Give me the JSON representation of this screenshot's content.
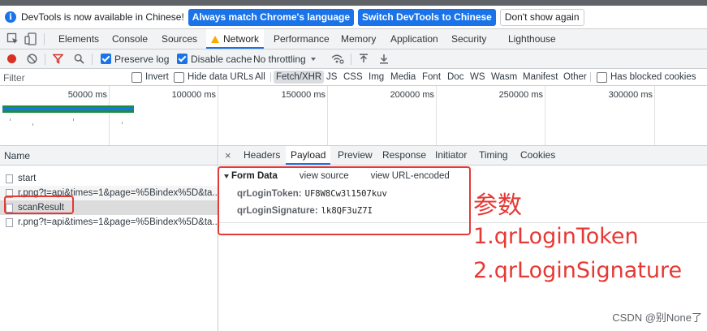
{
  "infobar": {
    "message": "DevTools is now available in Chinese!",
    "buttons": [
      "Always match Chrome's language",
      "Switch DevTools to Chinese",
      "Don't show again"
    ]
  },
  "main_tabs": [
    "Elements",
    "Console",
    "Sources",
    "Network",
    "Performance",
    "Memory",
    "Application",
    "Security",
    "Lighthouse"
  ],
  "active_main_tab": "Network",
  "toolbar": {
    "preserve_log": "Preserve log",
    "disable_cache": "Disable cache",
    "throttling": "No throttling"
  },
  "filter": {
    "placeholder": "Filter",
    "invert": "Invert",
    "hide_data_urls": "Hide data URLs",
    "types": [
      "All",
      "Fetch/XHR",
      "JS",
      "CSS",
      "Img",
      "Media",
      "Font",
      "Doc",
      "WS",
      "Wasm",
      "Manifest",
      "Other"
    ],
    "active_type": "Fetch/XHR",
    "blocked_cookies": "Has blocked cookies"
  },
  "overview": {
    "ticks": [
      "50000 ms",
      "100000 ms",
      "150000 ms",
      "200000 ms",
      "250000 ms",
      "300000 ms"
    ]
  },
  "request_list": {
    "header": "Name",
    "rows": [
      "start",
      "r.png?t=api&times=1&page=%5Bindex%5D&ta...",
      "scanResult",
      "r.png?t=api&times=1&page=%5Bindex%5D&ta..."
    ],
    "selected_index": 2
  },
  "details": {
    "close": "×",
    "tabs": [
      "Headers",
      "Payload",
      "Preview",
      "Response",
      "Initiator",
      "Timing",
      "Cookies"
    ],
    "active_tab": "Payload",
    "form_data": {
      "title": "Form Data",
      "view_source": "view source",
      "view_url_encoded": "view URL-encoded",
      "params": [
        {
          "key": "qrLoginToken:",
          "value": "UF8W8Cw3l1507kuv"
        },
        {
          "key": "qrLoginSignature:",
          "value": "lk8QF3uZ7I"
        }
      ]
    }
  },
  "annotation": {
    "title": "参数",
    "line1": "1.qrLoginToken",
    "line2": "2.qrLoginSignature",
    "color": "#e53935"
  },
  "watermark": "CSDN @别None了",
  "colors": {
    "accent": "#1a73e8",
    "record": "#d93025",
    "filter_icon": "#d93025",
    "warning": "#f9ab00"
  }
}
